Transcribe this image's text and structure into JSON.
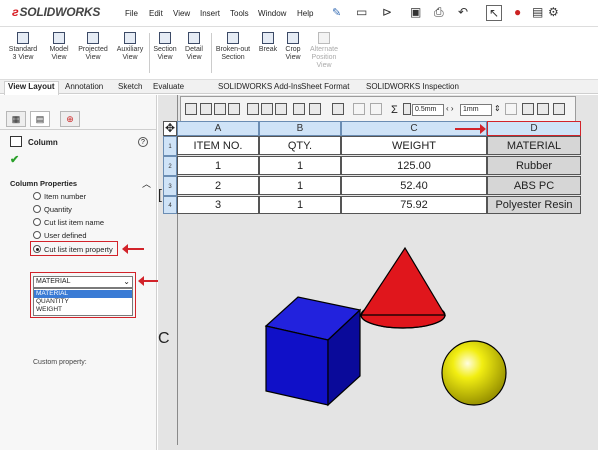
{
  "app": {
    "brand": "SOLIDWORKS",
    "menus": [
      "File",
      "Edit",
      "View",
      "Insert",
      "Tools",
      "Window",
      "Help"
    ]
  },
  "ribbon": {
    "buttons": [
      {
        "label": "Standard 3 View",
        "dim": false
      },
      {
        "label": "Model View",
        "dim": false
      },
      {
        "label": "Projected View",
        "dim": false
      },
      {
        "label": "Auxiliary View",
        "dim": false
      },
      {
        "label": "Section View",
        "dim": false
      },
      {
        "label": "Detail View",
        "dim": false
      },
      {
        "label": "Broken-out Section",
        "dim": false
      },
      {
        "label": "Break",
        "dim": false
      },
      {
        "label": "Crop View",
        "dim": false
      },
      {
        "label": "Alternate Position View",
        "dim": true
      }
    ]
  },
  "tabs": [
    "View Layout",
    "Annotation",
    "Sketch",
    "Evaluate",
    "SOLIDWORKS Add-Ins",
    "Sheet Format",
    "SOLIDWORKS Inspection"
  ],
  "property_manager": {
    "title": "Column",
    "section": "Column Properties",
    "options": [
      {
        "label": "Item number",
        "selected": false
      },
      {
        "label": "Quantity",
        "selected": false
      },
      {
        "label": "Cut list item name",
        "selected": false
      },
      {
        "label": "User defined",
        "selected": false
      },
      {
        "label": "Cut list item property",
        "selected": true
      }
    ],
    "custom_property_label": "Custom property:",
    "custom_property_value": "MATERIAL",
    "dropdown_options": [
      "MATERIAL",
      "QUANTITY",
      "WEIGHT"
    ]
  },
  "table_toolbar": {
    "line_width": "0.5mm",
    "spacing": "1mm"
  },
  "bom": {
    "column_letters": [
      "A",
      "B",
      "C",
      "D"
    ],
    "row_numbers": [
      "1",
      "2",
      "3",
      "4"
    ],
    "headers": [
      "ITEM NO.",
      "QTY.",
      "WEIGHT",
      "MATERIAL"
    ],
    "rows": [
      [
        "1",
        "1",
        "125.00",
        "Rubber"
      ],
      [
        "2",
        "1",
        "52.40",
        "ABS PC"
      ],
      [
        "3",
        "1",
        "75.92",
        "Polyester Resin"
      ]
    ]
  },
  "canvas": {
    "left_letter": "C",
    "bracket": "["
  },
  "colors": {
    "cube": "#1010c8",
    "cone": "#e0161c",
    "sphere": "#f2ee12",
    "highlight": "#d2232a",
    "column_header": "#cfe3f7"
  }
}
